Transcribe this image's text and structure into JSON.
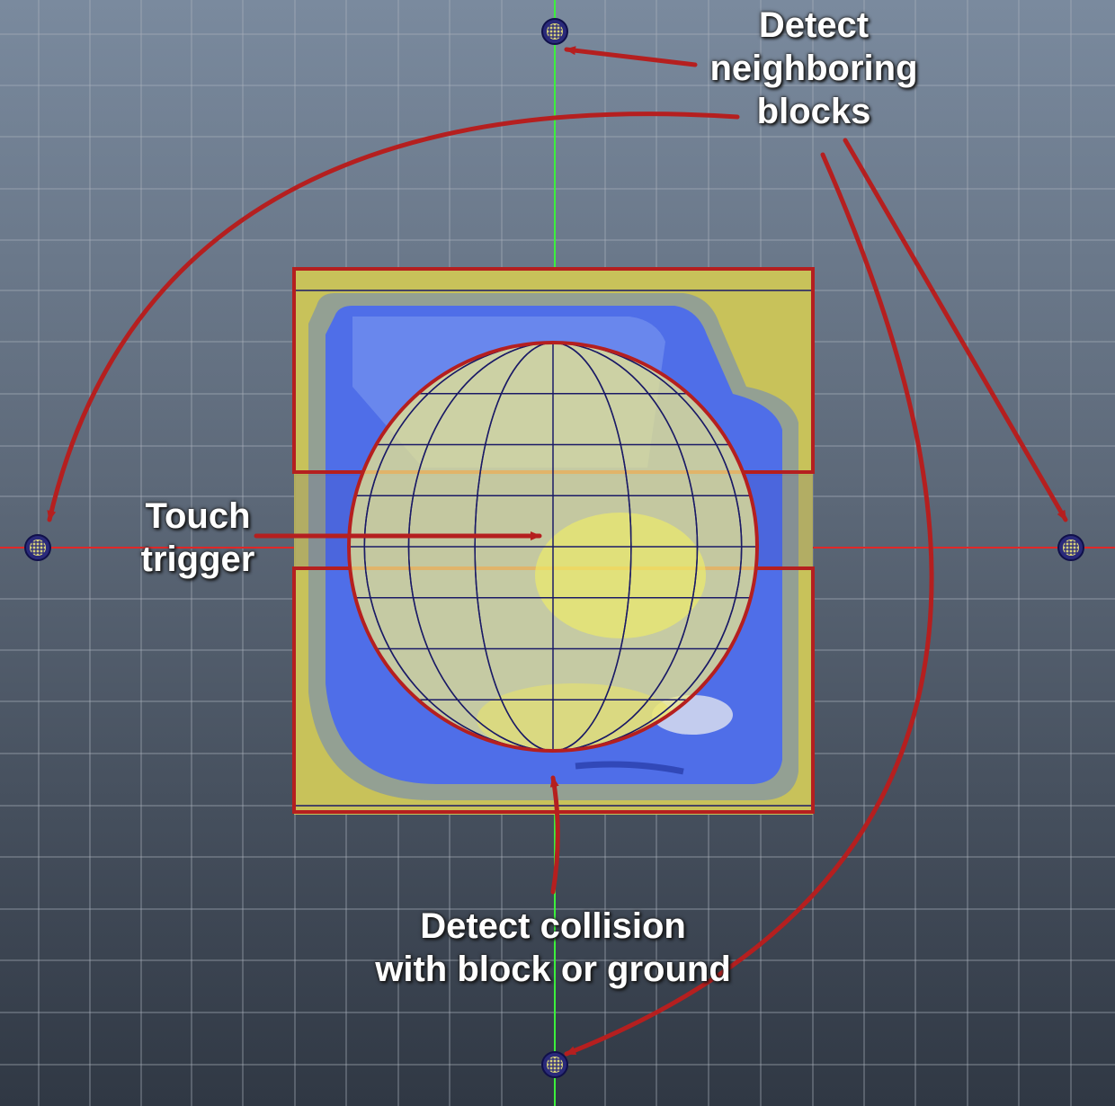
{
  "annotations": {
    "neighbors": "Detect\nneighboring\nblocks",
    "touch": "Touch\ntrigger",
    "collision": "Detect collision\nwith block or ground"
  },
  "colors": {
    "arrow": "#b51f1f",
    "vertical_axis": "#3cf03c",
    "horizontal_axis": "#e02828",
    "grid": "#aab2bd",
    "block_blue": "#4f6ee8",
    "block_yellow": "#c8c25a",
    "sphere": "#f2ee88",
    "sphere_wire": "#1a1a66",
    "detector_node": "#2a2a7a"
  },
  "icons": [
    "detector-node-icon",
    "block-face-icon",
    "sphere-trigger-icon"
  ]
}
